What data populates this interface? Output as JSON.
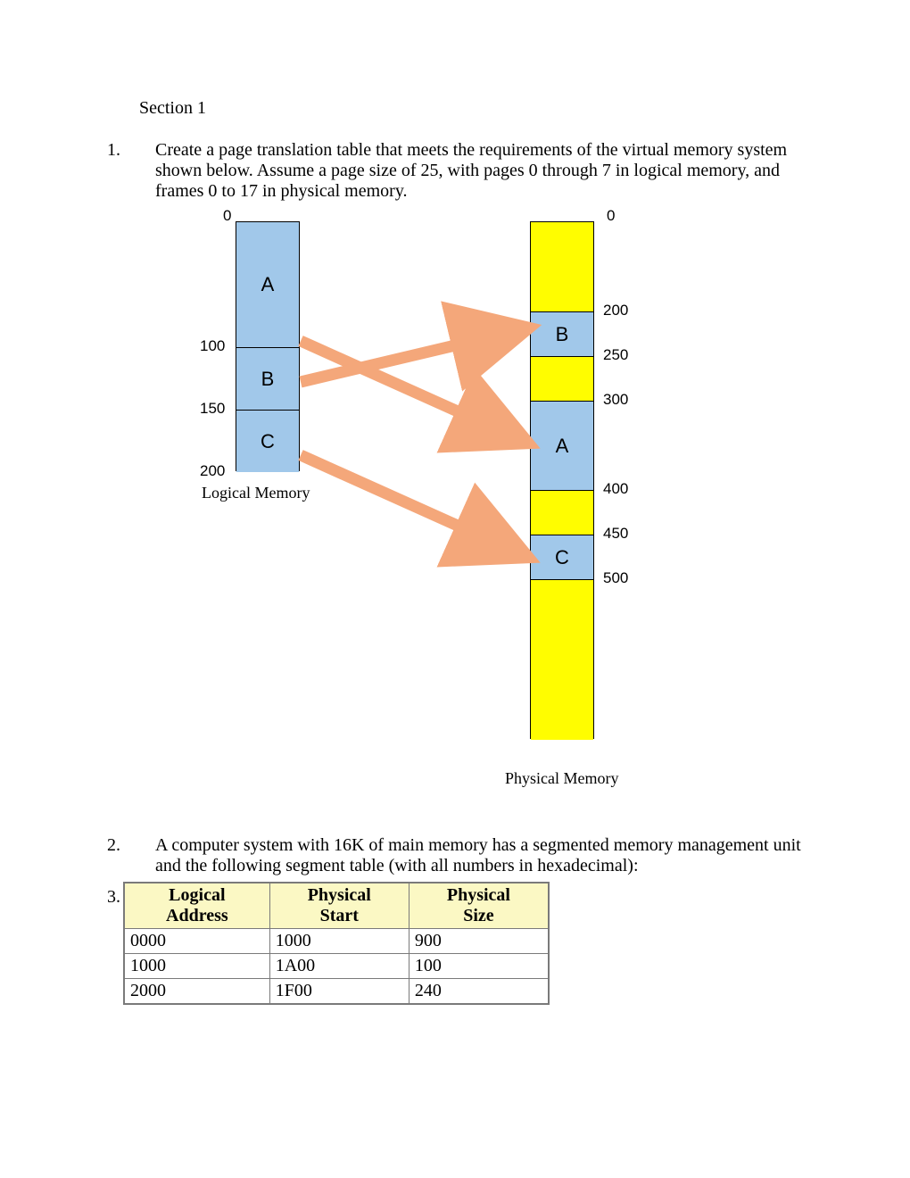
{
  "section_title": "Section 1",
  "questions": {
    "q1": {
      "num": "1.",
      "text": "Create a page translation table that meets the requirements of the virtual memory system shown below. Assume a page size of 25, with pages 0 through 7 in logical memory, and frames 0 to 17 in physical memory."
    },
    "q2": {
      "num": "2.",
      "text": "A computer system with 16K of main memory has a segmented memory management unit and the following segment table (with all numbers in hexadecimal):"
    },
    "q3_num": "3."
  },
  "diagram": {
    "logical": {
      "caption": "Logical Memory",
      "ticks": {
        "t0": "0",
        "t100": "100",
        "t150": "150",
        "t200": "200"
      },
      "labels": {
        "A": "A",
        "B": "B",
        "C": "C"
      }
    },
    "physical": {
      "caption": "Physical Memory",
      "ticks": {
        "t0": "0",
        "t200": "200",
        "t250": "250",
        "t300": "300",
        "t400": "400",
        "t450": "450",
        "t500": "500"
      },
      "labels": {
        "A": "A",
        "B": "B",
        "C": "C"
      }
    }
  },
  "table": {
    "headers": {
      "h1a": "Logical",
      "h1b": "Address",
      "h2a": "Physical",
      "h2b": "Start",
      "h3a": "Physical",
      "h3b": "Size"
    },
    "rows": [
      {
        "c1": "0000",
        "c2": "1000",
        "c3": "900"
      },
      {
        "c1": "1000",
        "c2": "1A00",
        "c3": "100"
      },
      {
        "c1": "2000",
        "c2": "1F00",
        "c3": "240"
      }
    ]
  }
}
